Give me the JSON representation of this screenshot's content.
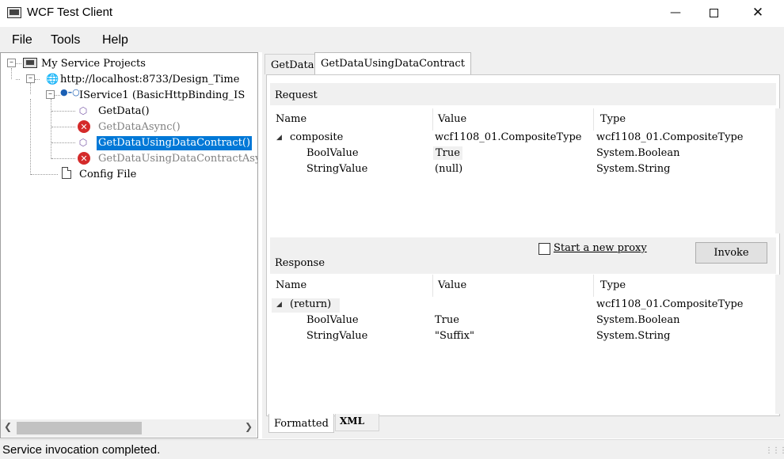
{
  "window": {
    "title": "WCF Test Client"
  },
  "menu": [
    "File",
    "Tools",
    "Help"
  ],
  "tree": {
    "root": "My Service Projects",
    "endpoint": "http://localhost:8733/Design_Time",
    "contract": "IService1 (BasicHttpBinding_IS",
    "operations": [
      {
        "label": "GetData()",
        "state": "ok"
      },
      {
        "label": "GetDataAsync()",
        "state": "error"
      },
      {
        "label": "GetDataUsingDataContract()",
        "state": "selected"
      },
      {
        "label": "GetDataUsingDataContractAsy",
        "state": "error"
      }
    ],
    "config": "Config File"
  },
  "tabs": [
    "GetData",
    "GetDataUsingDataContract"
  ],
  "request": {
    "label": "Request",
    "columns": [
      "Name",
      "Value",
      "Type"
    ],
    "rows": [
      {
        "name": "composite",
        "value": "wcf1108_01.CompositeType",
        "type": "wcf1108_01.CompositeType"
      },
      {
        "name": "BoolValue",
        "value": "True",
        "type": "System.Boolean"
      },
      {
        "name": "StringValue",
        "value": "(null)",
        "type": "System.String"
      }
    ]
  },
  "proxy": {
    "label": "Start a new proxy",
    "checked": false
  },
  "invoke_label": "Invoke",
  "response": {
    "label": "Response",
    "columns": [
      "Name",
      "Value",
      "Type"
    ],
    "rows": [
      {
        "name": "(return)",
        "value": "",
        "type": "wcf1108_01.CompositeType"
      },
      {
        "name": "BoolValue",
        "value": "True",
        "type": "System.Boolean"
      },
      {
        "name": "StringValue",
        "value": "\"Suffix\"",
        "type": "System.String"
      }
    ]
  },
  "bottom_tabs": [
    "Formatted",
    "XML"
  ],
  "status": "Service invocation completed.",
  "colors": {
    "selection": "#0078d7",
    "error": "#d42a2a",
    "chrome": "#f0f0f0"
  },
  "icons": [
    "app-icon",
    "globe-icon",
    "interface-icon",
    "cube-icon",
    "error-icon",
    "file-icon"
  ]
}
